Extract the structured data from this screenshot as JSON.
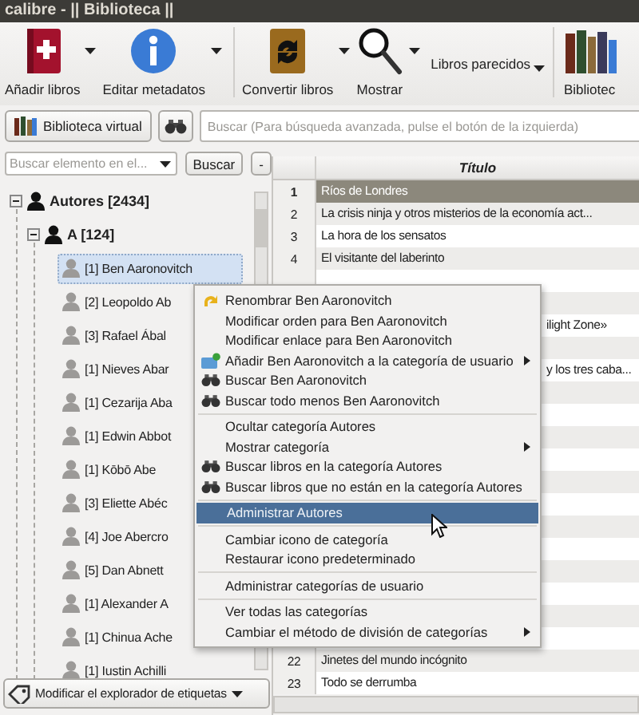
{
  "window": {
    "title": "calibre - || Biblioteca ||"
  },
  "toolbar": [
    {
      "kind": "add",
      "label": "Añadir libros",
      "dropdown": true
    },
    {
      "kind": "edit",
      "label": "Editar metadatos",
      "dropdown": true
    },
    {
      "kind": "convert",
      "label": "Convertir libros",
      "dropdown": true
    },
    {
      "kind": "view",
      "label": "Mostrar",
      "dropdown": true
    },
    {
      "kind": "text",
      "label": "Libros parecidos",
      "dropdown": true
    },
    {
      "kind": "library",
      "label": "Bibliotec",
      "dropdown": false
    }
  ],
  "search_bar": {
    "virtual_library": "Biblioteca virtual",
    "placeholder": "Buscar (Para búsqueda avanzada, pulse el botón de la izquierda)"
  },
  "tag_browser": {
    "find_placeholder": "Buscar elemento en el...",
    "find_button": "Buscar",
    "collapse_button": "-",
    "tree": [
      {
        "label": "Autores [2434]",
        "expanded": true,
        "children": [
          {
            "label": "A [124]",
            "expanded": true,
            "children": [
              {
                "label": "[1] Ben Aaronovitch",
                "selected": true
              },
              {
                "label": "[2] Leopoldo Ab",
                "selected": false
              },
              {
                "label": "[3] Rafael Ábal",
                "selected": false
              },
              {
                "label": "[1] Nieves Abar",
                "selected": false
              },
              {
                "label": "[1] Cezarija Aba",
                "selected": false
              },
              {
                "label": "[1] Edwin Abbot",
                "selected": false
              },
              {
                "label": "[1] Kōbō Abe",
                "selected": false
              },
              {
                "label": "[3] Eliette Abéc",
                "selected": false
              },
              {
                "label": "[4] Joe Abercro",
                "selected": false
              },
              {
                "label": "[5] Dan Abnett",
                "selected": false
              },
              {
                "label": "[1] Alexander A",
                "selected": false
              },
              {
                "label": "[1] Chinua Ache",
                "selected": false
              },
              {
                "label": "[1] Iustin Achilli",
                "selected": false
              }
            ]
          }
        ]
      }
    ],
    "footer_button": "Modificar el explorador de etiquetas"
  },
  "book_list": {
    "columns": [
      "Título"
    ],
    "rows": [
      {
        "number": "1",
        "title": "Ríos de Londres",
        "selected": true,
        "covered": false
      },
      {
        "number": "2",
        "title": "La crisis ninja y otros misterios de la economía act...",
        "selected": false,
        "covered": false
      },
      {
        "number": "3",
        "title": "La hora de los sensatos",
        "selected": false,
        "covered": false
      },
      {
        "number": "4",
        "title": "El visitante del laberinto",
        "selected": false,
        "covered": false
      },
      {
        "selected": false
      },
      {
        "selected": false
      },
      {
        "title": "ilight Zone»",
        "selected": false,
        "covered": true
      },
      {
        "selected": false
      },
      {
        "title": "y los tres caba...",
        "selected": false,
        "covered": true
      },
      {
        "selected": false
      },
      {
        "selected": false
      },
      {
        "selected": false
      },
      {
        "selected": false
      },
      {
        "selected": false
      },
      {
        "selected": false
      },
      {
        "selected": false
      },
      {
        "selected": false
      },
      {
        "selected": false
      },
      {
        "selected": false
      },
      {
        "selected": false
      },
      {
        "selected": false
      },
      {
        "number": "22",
        "title": "Jinetes del mundo incógnito",
        "selected": false,
        "covered": false
      },
      {
        "number": "23",
        "title": "Todo se derrumba",
        "selected": false,
        "covered": false
      }
    ]
  },
  "context_menu": {
    "items": [
      {
        "kind": "rename",
        "label": "Renombrar Ben Aaronovitch",
        "submenu": false,
        "selected": false
      },
      {
        "kind": "plain",
        "label": "Modificar orden para Ben Aaronovitch",
        "submenu": false,
        "selected": false
      },
      {
        "kind": "plain",
        "label": "Modificar enlace para Ben Aaronovitch",
        "submenu": false,
        "selected": false
      },
      {
        "kind": "user-category",
        "label": "Añadir Ben Aaronovitch a la categoría de usuario",
        "submenu": true,
        "selected": false
      },
      {
        "kind": "search",
        "label": "Buscar Ben Aaronovitch",
        "submenu": false,
        "selected": false
      },
      {
        "kind": "search",
        "label": "Buscar todo menos Ben Aaronovitch",
        "submenu": false,
        "selected": false
      },
      {
        "kind": "separator"
      },
      {
        "kind": "plain",
        "label": "Ocultar categoría Autores",
        "submenu": false,
        "selected": false
      },
      {
        "kind": "plain",
        "label": "Mostrar categoría",
        "submenu": true,
        "selected": false
      },
      {
        "kind": "search",
        "label": "Buscar libros en la categoría Autores",
        "submenu": false,
        "selected": false
      },
      {
        "kind": "search",
        "label": "Buscar libros que no están en la categoría Autores",
        "submenu": false,
        "selected": false
      },
      {
        "kind": "separator"
      },
      {
        "kind": "plain",
        "label": "Administrar Autores",
        "submenu": false,
        "selected": true
      },
      {
        "kind": "separator"
      },
      {
        "kind": "plain",
        "label": "Cambiar icono de categoría",
        "submenu": false,
        "selected": false
      },
      {
        "kind": "plain",
        "label": "Restaurar icono predeterminado",
        "submenu": false,
        "selected": false
      },
      {
        "kind": "separator"
      },
      {
        "kind": "plain",
        "label": "Administrar categorías de usuario",
        "submenu": false,
        "selected": false
      },
      {
        "kind": "separator"
      },
      {
        "kind": "plain",
        "label": "Ver todas las categorías",
        "submenu": false,
        "selected": false
      },
      {
        "kind": "plain",
        "label": "Cambiar el método de división de categorías",
        "submenu": true,
        "selected": false
      }
    ]
  }
}
